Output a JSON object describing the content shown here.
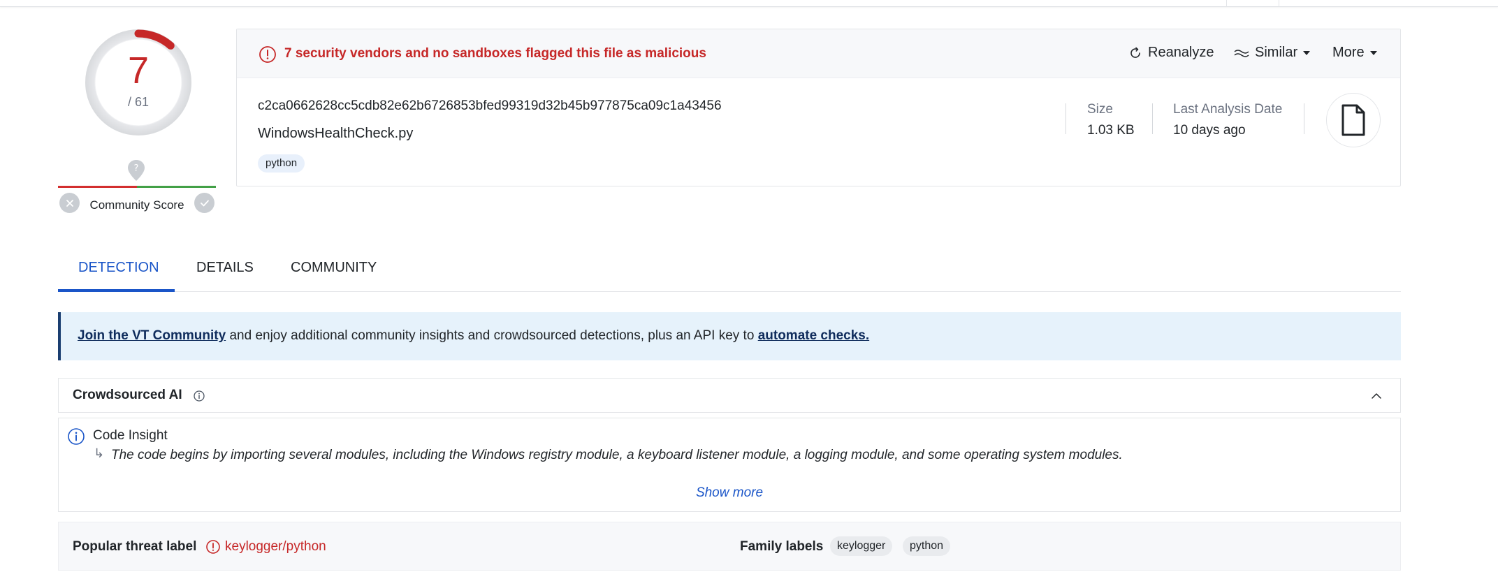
{
  "score": {
    "detections": "7",
    "total": "/ 61",
    "detections_value": 7,
    "total_value": 61,
    "community_score_label": "Community Score",
    "colors": {
      "malicious": "#c62828",
      "ring": "#e6e7ea"
    }
  },
  "file": {
    "alert_text": "7 security vendors and no sandboxes flagged this file as malicious",
    "hash": "c2ca0662628cc5cdb82e62b6726853bfed99319d32b45b977875ca09c1a43456",
    "name": "WindowsHealthCheck.py",
    "tag": "python",
    "size_label": "Size",
    "size_value": "1.03 KB",
    "date_label": "Last Analysis Date",
    "date_value": "10 days ago",
    "file_icon": "file-icon"
  },
  "actions": {
    "reanalyze": "Reanalyze",
    "similar": "Similar",
    "more": "More"
  },
  "tabs": [
    {
      "label": "DETECTION",
      "active": true
    },
    {
      "label": "DETAILS",
      "active": false
    },
    {
      "label": "COMMUNITY",
      "active": false
    }
  ],
  "banner": {
    "link1": "Join the VT Community",
    "middle": " and enjoy additional community insights and crowdsourced detections, plus an API key to ",
    "link2": "automate checks."
  },
  "crowdsourced_ai": {
    "title": "Crowdsourced AI",
    "insight_title": "Code Insight",
    "insight_arrow": "↳",
    "insight_text": "The code begins by importing several modules, including the Windows registry module, a keyboard listener module, a logging module, and some operating system modules.",
    "show_more": "Show more"
  },
  "threat": {
    "popular_label": "Popular threat label",
    "popular_value": "keylogger/python",
    "family_label": "Family labels",
    "families": [
      "keylogger",
      "python"
    ]
  }
}
